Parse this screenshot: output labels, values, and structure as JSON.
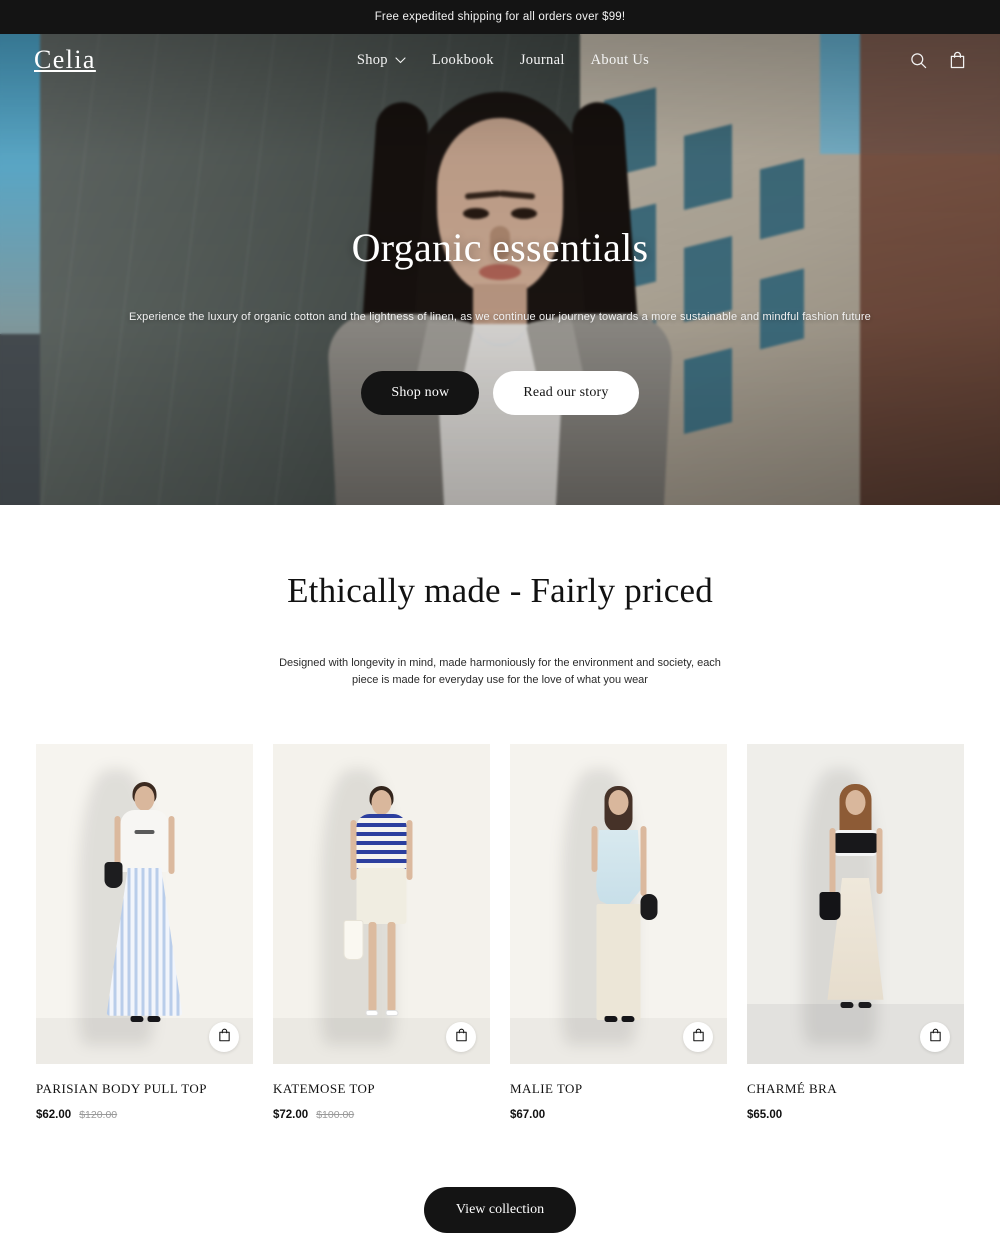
{
  "announcement": {
    "text": "Free expedited shipping for all orders over $99!"
  },
  "header": {
    "logo": "Celia",
    "nav": [
      {
        "label": "Shop",
        "has_dropdown": true,
        "icon": "chevron-down-icon"
      },
      {
        "label": "Lookbook",
        "has_dropdown": false
      },
      {
        "label": "Journal",
        "has_dropdown": false
      },
      {
        "label": "About Us",
        "has_dropdown": false
      }
    ],
    "icons": [
      {
        "name": "search-icon"
      },
      {
        "name": "shopping-bag-icon"
      }
    ]
  },
  "hero": {
    "title": "Organic essentials",
    "subtitle": "Experience the luxury of organic cotton and the lightness of linen, as we continue our journey towards a more sustainable and mindful fashion future",
    "primary_button": "Shop now",
    "secondary_button": "Read our story",
    "image_description": "Woman in grey coat and white tee standing before a concrete wall with blue sky and a building facade"
  },
  "values_section": {
    "title": "Ethically made - Fairly priced",
    "subtitle": "Designed with longevity in mind, made harmoniously for the environment and society, each piece is made for everyday use for the love of what you wear"
  },
  "products": [
    {
      "name": "PARISIAN BODY PULL TOP",
      "price": "$62.00",
      "compare_at_price": "$120.00",
      "add_to_cart_icon": "shopping-bag-icon",
      "image_description": "Model in white tee and blue striped maxi skirt with black bag"
    },
    {
      "name": "KATEMOSE TOP",
      "price": "$72.00",
      "compare_at_price": "$100.00",
      "add_to_cart_icon": "shopping-bag-icon",
      "image_description": "Model in navy striped tee and cream mini skirt with white tote"
    },
    {
      "name": "MALIE TOP",
      "price": "$67.00",
      "compare_at_price": "",
      "add_to_cart_icon": "shopping-bag-icon",
      "image_description": "Model in light blue peplum camisole and cream wide-leg trousers"
    },
    {
      "name": "CHARMÉ BRA",
      "price": "$65.00",
      "compare_at_price": "",
      "add_to_cart_icon": "shopping-bag-icon",
      "image_description": "Model in black and white bra top and cream satin midi skirt"
    }
  ],
  "collection_cta": {
    "label": "View collection"
  },
  "colors": {
    "announcement_bg": "#141414",
    "button_dark": "#141414",
    "button_light": "#ffffff",
    "text_primary": "#111111",
    "compare_price": "#9a9a9a",
    "product_bg": "#f3f1ec"
  }
}
